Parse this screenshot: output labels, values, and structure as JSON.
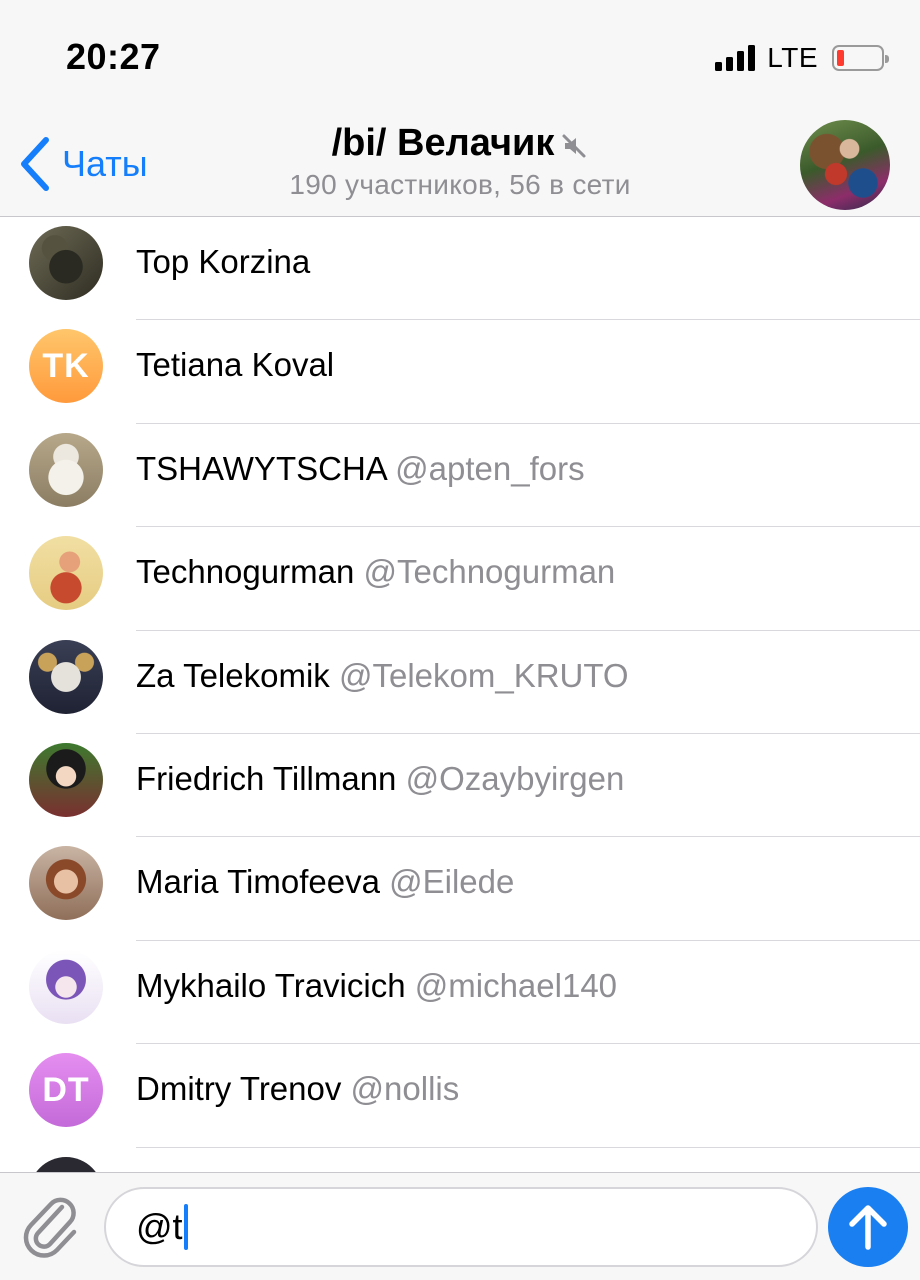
{
  "status_bar": {
    "time": "20:27",
    "network": "LTE",
    "battery_level": 0.15,
    "battery_color": "#ff3b30"
  },
  "header": {
    "back_label": "Чаты",
    "back_icon": "chevron-left-icon",
    "title": "/bi/ Велачик",
    "muted_icon": "mute-icon",
    "subtitle": "190 участников, 56 в сети",
    "accent_color": "#157efb"
  },
  "mentions": [
    {
      "name": "Top Korzina",
      "handle": ""
    },
    {
      "name": "Tetiana Koval",
      "handle": "",
      "initials": "TK"
    },
    {
      "name": "TSHAWYTSCHA",
      "handle": "@apten_fors"
    },
    {
      "name": "Technogurman",
      "handle": "@Technogurman"
    },
    {
      "name": "Za Telekomik",
      "handle": "@Telekom_KRUTO"
    },
    {
      "name": "Friedrich Tillmann",
      "handle": "@Ozaybyirgen"
    },
    {
      "name": "Maria Timofeeva",
      "handle": "@Eilede"
    },
    {
      "name": "Mykhailo Travicich",
      "handle": "@michael140"
    },
    {
      "name": "Dmitry Trenov",
      "handle": "@nollis",
      "initials": "DT"
    }
  ],
  "composer": {
    "attach_icon": "paperclip-icon",
    "text": "@t",
    "send_icon": "arrow-up-icon",
    "send_color": "#1a7ff0"
  }
}
